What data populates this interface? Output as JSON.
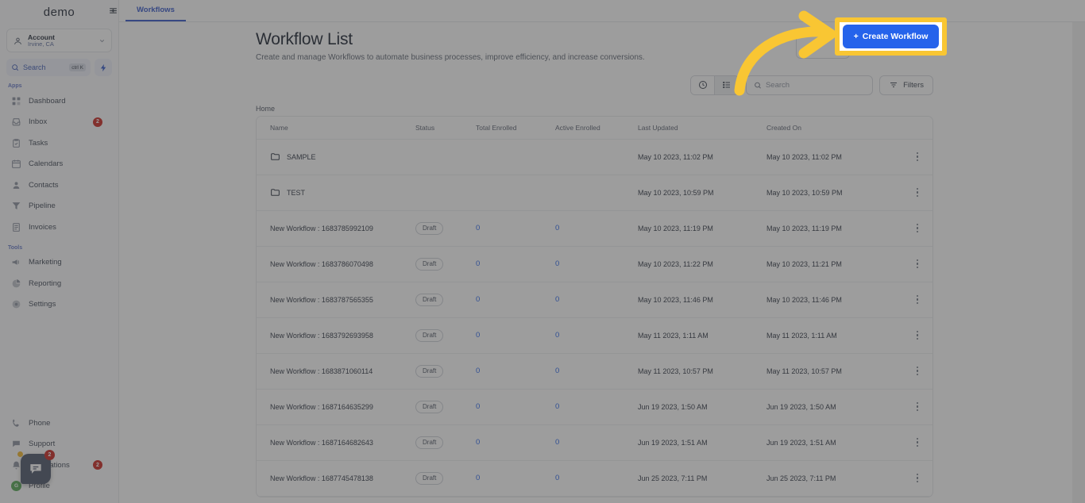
{
  "sidebar": {
    "brand": "demo",
    "account": {
      "name": "Account",
      "location": "Irvine, CA"
    },
    "search": {
      "label": "Search",
      "shortcut": "ctrl K"
    },
    "sections": [
      {
        "title": "Apps",
        "items": [
          {
            "label": "Dashboard",
            "icon": "grid-icon",
            "badge": ""
          },
          {
            "label": "Inbox",
            "icon": "inbox-icon",
            "badge": "2"
          },
          {
            "label": "Tasks",
            "icon": "clipboard-icon",
            "badge": ""
          },
          {
            "label": "Calendars",
            "icon": "calendar-icon",
            "badge": ""
          },
          {
            "label": "Contacts",
            "icon": "user-icon",
            "badge": ""
          },
          {
            "label": "Pipeline",
            "icon": "funnel-icon",
            "badge": ""
          },
          {
            "label": "Invoices",
            "icon": "invoice-icon",
            "badge": ""
          }
        ]
      },
      {
        "title": "Tools",
        "items": [
          {
            "label": "Marketing",
            "icon": "megaphone-icon",
            "badge": ""
          },
          {
            "label": "Reporting",
            "icon": "pie-chart-icon",
            "badge": ""
          },
          {
            "label": "Settings",
            "icon": "gear-icon",
            "badge": ""
          }
        ]
      }
    ],
    "bottom": [
      {
        "label": "Phone",
        "icon": "phone-icon",
        "badge": ""
      },
      {
        "label": "Support",
        "icon": "chat-icon",
        "badge": ""
      },
      {
        "label": "Notifications",
        "icon": "bell-icon",
        "badge": "2"
      }
    ],
    "profile": {
      "label": "Profile",
      "initials": "G"
    }
  },
  "tabbar": {
    "tab_label": "Workflows",
    "collapse_icon": "collapse-sidebar-icon"
  },
  "header": {
    "title": "Workflow List",
    "subtitle": "Create and manage Workflows to automate business processes, improve efficiency, and increase conversions.",
    "secondary_button": "",
    "create_button": "Create Workflow",
    "create_button_color": "#2563eb"
  },
  "toolbar": {
    "history_icon": "clock-icon",
    "list_icon": "list-view-icon",
    "search_placeholder": "Search",
    "search_value": "",
    "filters_label": "Filters"
  },
  "breadcrumb": "Home",
  "table": {
    "columns": [
      "Name",
      "Status",
      "Total Enrolled",
      "Active Enrolled",
      "Last Updated",
      "Created On"
    ],
    "rows": [
      {
        "name": "SAMPLE",
        "type": "folder",
        "status": "",
        "total": "",
        "active": "",
        "updated": "May 10 2023, 11:02 PM",
        "created": "May 10 2023, 11:02 PM"
      },
      {
        "name": "TEST",
        "type": "folder",
        "status": "",
        "total": "",
        "active": "",
        "updated": "May 10 2023, 10:59 PM",
        "created": "May 10 2023, 10:59 PM"
      },
      {
        "name": "New Workflow : 1683785992109",
        "type": "workflow",
        "status": "Draft",
        "total": "0",
        "active": "0",
        "updated": "May 10 2023, 11:19 PM",
        "created": "May 10 2023, 11:19 PM"
      },
      {
        "name": "New Workflow : 1683786070498",
        "type": "workflow",
        "status": "Draft",
        "total": "0",
        "active": "0",
        "updated": "May 10 2023, 11:22 PM",
        "created": "May 10 2023, 11:21 PM"
      },
      {
        "name": "New Workflow : 1683787565355",
        "type": "workflow",
        "status": "Draft",
        "total": "0",
        "active": "0",
        "updated": "May 10 2023, 11:46 PM",
        "created": "May 10 2023, 11:46 PM"
      },
      {
        "name": "New Workflow : 1683792693958",
        "type": "workflow",
        "status": "Draft",
        "total": "0",
        "active": "0",
        "updated": "May 11 2023, 1:11 AM",
        "created": "May 11 2023, 1:11 AM"
      },
      {
        "name": "New Workflow : 1683871060114",
        "type": "workflow",
        "status": "Draft",
        "total": "0",
        "active": "0",
        "updated": "May 11 2023, 10:57 PM",
        "created": "May 11 2023, 10:57 PM"
      },
      {
        "name": "New Workflow : 1687164635299",
        "type": "workflow",
        "status": "Draft",
        "total": "0",
        "active": "0",
        "updated": "Jun 19 2023, 1:50 AM",
        "created": "Jun 19 2023, 1:50 AM"
      },
      {
        "name": "New Workflow : 1687164682643",
        "type": "workflow",
        "status": "Draft",
        "total": "0",
        "active": "0",
        "updated": "Jun 19 2023, 1:51 AM",
        "created": "Jun 19 2023, 1:51 AM"
      },
      {
        "name": "New Workflow : 1687745478138",
        "type": "workflow",
        "status": "Draft",
        "total": "0",
        "active": "0",
        "updated": "Jun 25 2023, 7:11 PM",
        "created": "Jun 25 2023, 7:11 PM"
      }
    ]
  },
  "chat_widget": {
    "badge": "2",
    "icon": "chat-bubble-icon"
  },
  "annotation": {
    "highlight_color": "#f9c633",
    "arrow_icon": "curved-arrow-icon"
  }
}
